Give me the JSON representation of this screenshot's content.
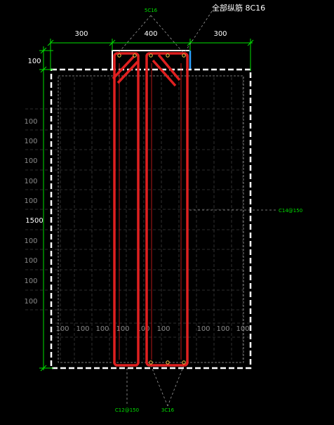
{
  "labels": {
    "top_rebar": "5C16",
    "all_longitudinal": "全部纵筋 8C16",
    "side_rebar": "C14@150",
    "bottom_stirrup": "C12@150",
    "bottom_rebar": "3C16"
  },
  "dims": {
    "top": [
      "300",
      "400",
      "300"
    ],
    "left_top": "100",
    "left_total": "1500",
    "grid_left": [
      "100",
      "100",
      "100",
      "100",
      "100",
      "100",
      "100",
      "100",
      "100",
      "100"
    ],
    "grid_bottom": [
      "100",
      "100",
      "100",
      "100",
      "100",
      "100",
      "100",
      "100",
      "100"
    ]
  },
  "colors": {
    "background": "#000000",
    "rebar": "#e02020",
    "dimension": "#00e000",
    "outline": "#ffffff",
    "accent": "#2aa0ff",
    "grid": "#5a5a5a"
  }
}
